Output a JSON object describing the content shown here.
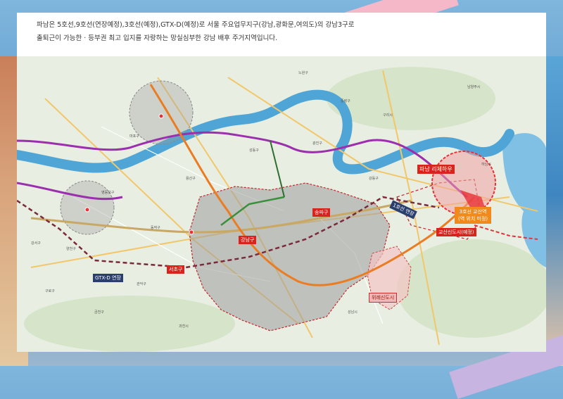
{
  "description": {
    "line1": "파남은 5호선,9호선(연장예정),3호선(예정),GTX-D(예정)로 서울 주요업무지구(강남,광화문,여의도)의 강남3구로",
    "line2": "출퇴근이 가능한 · 등부권 최고 입지를 자랑하는 망실심부한 강남 배후 주거지역입니다."
  },
  "map": {
    "highlight_label": "파남 리체하우",
    "district_labels": {
      "seocho": "서초구",
      "gangnam": "강남구",
      "songpa": "송파구",
      "hanam_gyosan": "교산신도시(예정)",
      "wirye": "위례신도시",
      "line_gtx": "GTX-D 연장"
    },
    "station_callout": {
      "line1": "3호선 교산역",
      "line2": "(역 위치 미정)"
    },
    "line_tag": "1호선 연장",
    "places": [
      "강서구",
      "양천구",
      "영등포구",
      "마포구",
      "용산구",
      "성동구",
      "광진구",
      "중랑구",
      "노원구",
      "구리시",
      "남양주시",
      "하남시",
      "강동구",
      "성남시",
      "과천시",
      "구로구",
      "금천구",
      "관악구",
      "동작구"
    ]
  },
  "colors": {
    "river": "#4fa6d6",
    "highlight": "#e8323a",
    "line5": "#9b2fae",
    "line9": "#c9a864",
    "line3": "#ea7d23",
    "gtx": "#7a2a3a",
    "district_fill": "#9c9c9c"
  }
}
